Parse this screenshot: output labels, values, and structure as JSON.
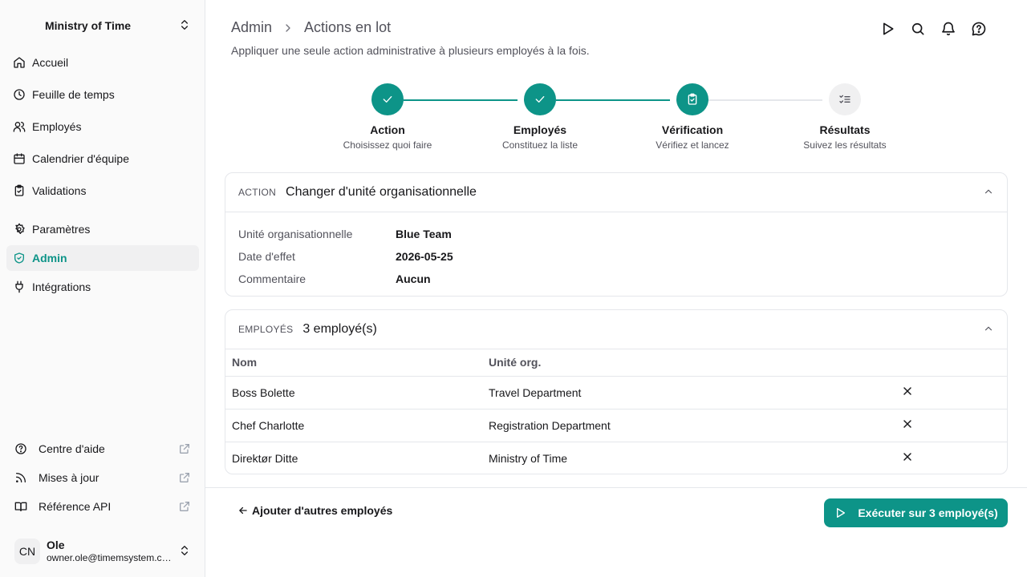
{
  "org": {
    "name": "Ministry of Time"
  },
  "nav": {
    "items": [
      {
        "label": "Accueil",
        "icon": "home-icon"
      },
      {
        "label": "Feuille de temps",
        "icon": "clock-icon"
      },
      {
        "label": "Employés",
        "icon": "users-icon"
      },
      {
        "label": "Calendrier d'équipe",
        "icon": "calendar-icon"
      },
      {
        "label": "Validations",
        "icon": "clipboard-check-icon"
      },
      {
        "label": "Paramètres",
        "icon": "gear-icon"
      },
      {
        "label": "Admin",
        "icon": "shield-check-icon",
        "active": true
      },
      {
        "label": "Intégrations",
        "icon": "plug-icon"
      }
    ],
    "bottom": [
      {
        "label": "Centre d'aide",
        "icon": "help-circle-icon"
      },
      {
        "label": "Mises à jour",
        "icon": "rss-icon"
      },
      {
        "label": "Référence API",
        "icon": "book-icon"
      }
    ]
  },
  "user": {
    "initials": "CN",
    "name": "Ole",
    "email": "owner.ole@timemsystem.com"
  },
  "header": {
    "breadcrumb": [
      "Admin",
      "Actions en lot"
    ],
    "subtitle": "Appliquer une seule action administrative à plusieurs employés à la fois."
  },
  "steps": [
    {
      "title": "Action",
      "desc": "Choisissez quoi faire",
      "state": "done"
    },
    {
      "title": "Employés",
      "desc": "Constituez la liste",
      "state": "done"
    },
    {
      "title": "Vérification",
      "desc": "Vérifiez et lancez",
      "state": "current"
    },
    {
      "title": "Résultats",
      "desc": "Suivez les résultats",
      "state": "todo"
    }
  ],
  "action_card": {
    "label": "ACTION",
    "value": "Changer d'unité organisationnelle",
    "fields": [
      {
        "key": "Unité organisationnelle",
        "value": "Blue Team"
      },
      {
        "key": "Date d'effet",
        "value": "2026-05-25"
      },
      {
        "key": "Commentaire",
        "value": "Aucun"
      }
    ]
  },
  "employees_card": {
    "label": "EMPLOYÉS",
    "value": "3 employé(s)",
    "columns": [
      "Nom",
      "Unité org."
    ],
    "rows": [
      {
        "name": "Boss Bolette",
        "unit": "Travel Department"
      },
      {
        "name": "Chef Charlotte",
        "unit": "Registration Department"
      },
      {
        "name": "Direktør Ditte",
        "unit": "Ministry of Time"
      }
    ]
  },
  "footer": {
    "back_label": "Ajouter d'autres employés",
    "run_label": "Exécuter sur 3 employé(s)"
  },
  "colors": {
    "accent": "#0d9488",
    "muted": "#52525b",
    "border": "#e5e7eb"
  }
}
